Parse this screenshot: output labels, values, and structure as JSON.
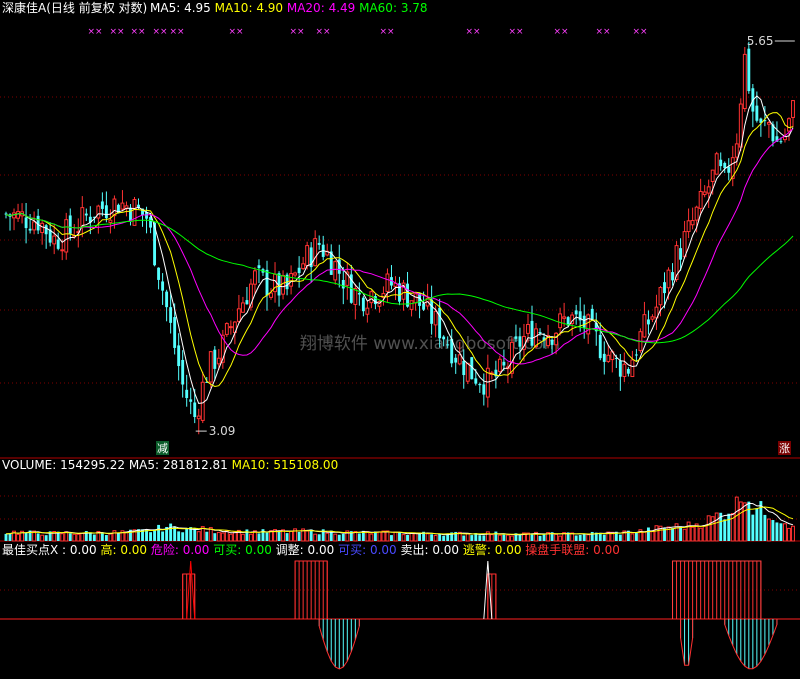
{
  "header": {
    "stock": "深康佳A",
    "period": "(日线 前复权 对数)",
    "ma": [
      {
        "label": "MA5: ",
        "value": "4.95",
        "color": "#ffffff"
      },
      {
        "label": "MA10: ",
        "value": "4.90",
        "color": "#ffff00"
      },
      {
        "label": "MA20: ",
        "value": "4.49",
        "color": "#ff00ff"
      },
      {
        "label": "MA60: ",
        "value": "3.78",
        "color": "#00ff00"
      }
    ]
  },
  "watermark": "翔博软件 www.xiangbosoft.com",
  "colors": {
    "up": "#ff3232",
    "down": "#54ffff",
    "ma5": "#ffffff",
    "ma10": "#ffff00",
    "ma20": "#ff00ff",
    "ma60": "#00ff00",
    "grid": "#800000",
    "border": "#b00000"
  },
  "markers": {
    "high_label": "5.65",
    "low_label": "3.09",
    "sell_signal": "减",
    "rise_signal": "涨",
    "top_marks": [
      "××",
      "××",
      "××",
      "××",
      "××",
      "××",
      "××",
      "××",
      "××",
      "××",
      "××",
      "××",
      "××",
      "××"
    ]
  },
  "volume_header": {
    "items": [
      {
        "label": "VOLUME: ",
        "value": "154295.22",
        "color": "#ffffff"
      },
      {
        "label": "MA5: ",
        "value": "281812.81",
        "color": "#ffffff"
      },
      {
        "label": "MA10: ",
        "value": "515108.00",
        "color": "#ffff00"
      }
    ]
  },
  "indicator_header": {
    "items": [
      {
        "label": "最佳买点X : ",
        "value": "0.00",
        "color": "#ffffff"
      },
      {
        "label": "高: ",
        "value": "0.00",
        "color": "#ffff00"
      },
      {
        "label": "危险: ",
        "value": "0.00",
        "color": "#ff00ff"
      },
      {
        "label": "可买: ",
        "value": "0.00",
        "color": "#00ff00"
      },
      {
        "label": "调整: ",
        "value": "0.00",
        "color": "#ffffff"
      },
      {
        "label": "可买: ",
        "value": "0.00",
        "color": "#4a4aff"
      },
      {
        "label": "卖出: ",
        "value": "0.00",
        "color": "#ffffff"
      },
      {
        "label": "逃警: ",
        "value": "0.00",
        "color": "#ffff00"
      },
      {
        "label": "操盘手联盟: ",
        "value": "0.00",
        "color": "#ff3232"
      }
    ]
  },
  "chart_data": {
    "type": "candlestick",
    "scale": "log",
    "ylim": [
      2.95,
      5.9
    ],
    "price_labels": {
      "high": 5.65,
      "low": 3.09
    },
    "keypoints": [
      [
        0,
        4.32
      ],
      [
        8,
        4.28
      ],
      [
        12,
        4.15
      ],
      [
        16,
        4.2
      ],
      [
        22,
        4.35
      ],
      [
        28,
        4.4
      ],
      [
        32,
        4.36
      ],
      [
        35,
        4.3
      ],
      [
        38,
        3.95
      ],
      [
        41,
        3.6
      ],
      [
        44,
        3.28
      ],
      [
        47,
        3.12
      ],
      [
        50,
        3.35
      ],
      [
        54,
        3.5
      ],
      [
        58,
        3.72
      ],
      [
        62,
        3.9
      ],
      [
        66,
        3.85
      ],
      [
        70,
        3.82
      ],
      [
        74,
        4.0
      ],
      [
        78,
        4.12
      ],
      [
        81,
        4.02
      ],
      [
        84,
        3.9
      ],
      [
        88,
        3.78
      ],
      [
        92,
        3.82
      ],
      [
        96,
        3.86
      ],
      [
        100,
        3.8
      ],
      [
        104,
        3.72
      ],
      [
        108,
        3.6
      ],
      [
        112,
        3.45
      ],
      [
        116,
        3.35
      ],
      [
        120,
        3.3
      ],
      [
        124,
        3.36
      ],
      [
        128,
        3.52
      ],
      [
        132,
        3.6
      ],
      [
        136,
        3.58
      ],
      [
        140,
        3.66
      ],
      [
        144,
        3.62
      ],
      [
        148,
        3.5
      ],
      [
        152,
        3.4
      ],
      [
        155,
        3.38
      ],
      [
        158,
        3.55
      ],
      [
        162,
        3.72
      ],
      [
        166,
        3.98
      ],
      [
        170,
        4.2
      ],
      [
        174,
        4.45
      ],
      [
        177,
        4.65
      ],
      [
        179,
        4.55
      ],
      [
        182,
        4.9
      ],
      [
        184,
        5.55
      ],
      [
        186,
        5.1
      ],
      [
        188,
        4.95
      ],
      [
        190,
        5.0
      ],
      [
        192,
        4.85
      ],
      [
        194,
        4.9
      ],
      [
        196,
        5.1
      ]
    ],
    "volume": {
      "keypoints": [
        [
          0,
          95000
        ],
        [
          10,
          80000
        ],
        [
          20,
          85000
        ],
        [
          30,
          90000
        ],
        [
          36,
          110000
        ],
        [
          40,
          150000
        ],
        [
          44,
          130000
        ],
        [
          48,
          120000
        ],
        [
          56,
          100000
        ],
        [
          66,
          95000
        ],
        [
          76,
          100000
        ],
        [
          90,
          85000
        ],
        [
          100,
          80000
        ],
        [
          110,
          75000
        ],
        [
          120,
          80000
        ],
        [
          130,
          70000
        ],
        [
          140,
          72000
        ],
        [
          150,
          80000
        ],
        [
          158,
          100000
        ],
        [
          164,
          140000
        ],
        [
          170,
          160000
        ],
        [
          174,
          200000
        ],
        [
          178,
          280000
        ],
        [
          182,
          380000
        ],
        [
          184,
          560000
        ],
        [
          186,
          350000
        ],
        [
          190,
          300000
        ],
        [
          196,
          154295
        ]
      ],
      "ylim": [
        0,
        700000
      ]
    },
    "indicator": {
      "positive_clusters": [
        [
          44,
          47
        ],
        [
          72,
          80
        ],
        [
          120,
          122
        ],
        [
          166,
          188
        ]
      ],
      "negative_clusters": [
        [
          78,
          88
        ],
        [
          168,
          171
        ],
        [
          179,
          192
        ]
      ],
      "spikes": [
        [
          46,
          "#ff0000"
        ],
        [
          120,
          "#ffffff"
        ]
      ]
    }
  }
}
